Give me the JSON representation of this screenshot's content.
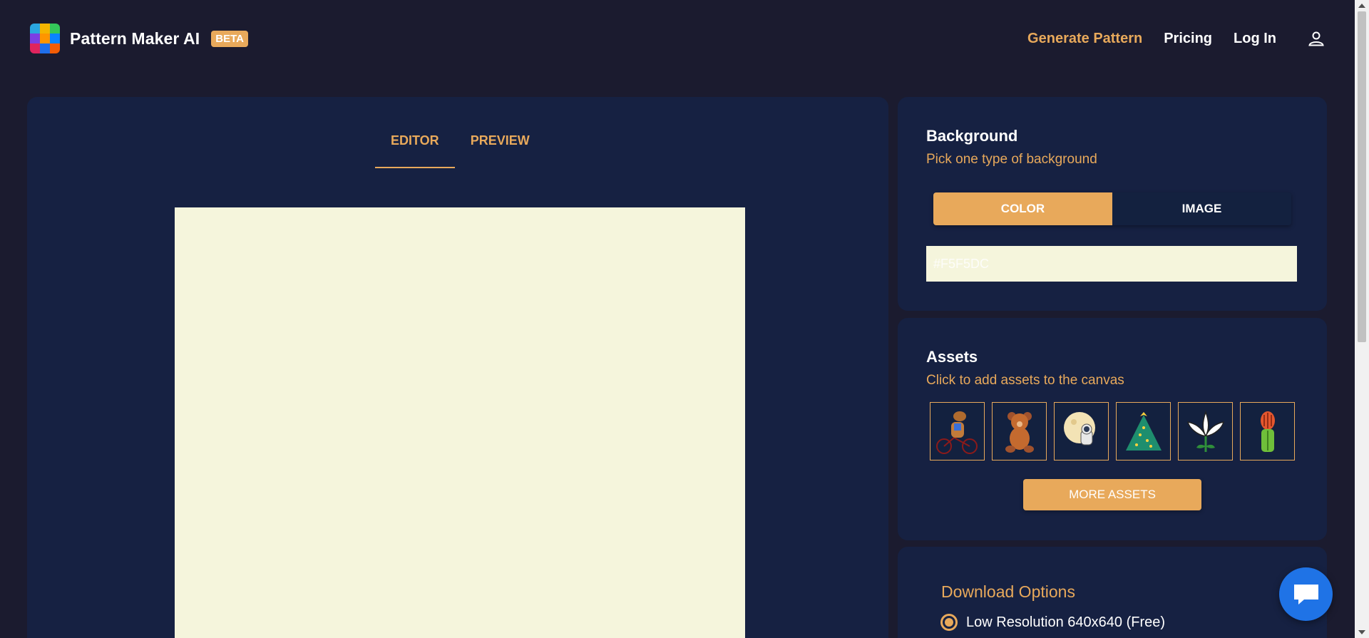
{
  "header": {
    "brand_name": "Pattern Maker AI",
    "badge": "BETA",
    "nav": {
      "generate": "Generate Pattern",
      "pricing": "Pricing",
      "login": "Log In"
    },
    "icons": {
      "logo": "logo-mosaic-icon",
      "user": "user-icon"
    }
  },
  "editor": {
    "tabs": [
      "EDITOR",
      "PREVIEW"
    ],
    "active_tab": "EDITOR",
    "canvas_color": "#F5F5DC"
  },
  "background_card": {
    "title": "Background",
    "subtitle": "Pick one type of background",
    "toggle": {
      "color": "COLOR",
      "image": "IMAGE",
      "selected": "COLOR"
    },
    "color_value": "#F5F5DC"
  },
  "assets_card": {
    "title": "Assets",
    "subtitle": "Click to add assets to the canvas",
    "assets": [
      "horse-on-bicycle-icon",
      "teddy-bear-icon",
      "astronaut-moon-icon",
      "christmas-tree-icon",
      "lily-flower-icon",
      "cactus-flower-icon"
    ],
    "more_button": "MORE ASSETS"
  },
  "download_card": {
    "title": "Download Options",
    "option": "Low Resolution 640x640 (Free)"
  },
  "colors": {
    "accent": "#E8A95B",
    "page_bg": "#1B1B2F",
    "panel_bg": "#162142",
    "chat_button": "#1F73E6"
  }
}
